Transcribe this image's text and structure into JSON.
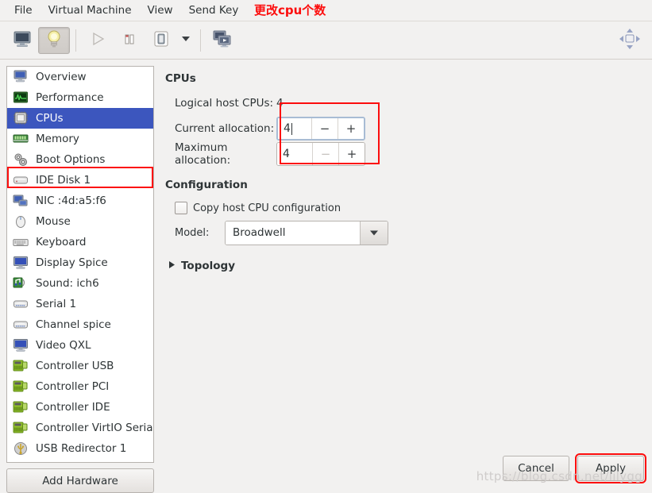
{
  "menubar": {
    "items": [
      {
        "label": "File",
        "name": "menu-file"
      },
      {
        "label": "Virtual Machine",
        "name": "menu-virtual-machine"
      },
      {
        "label": "View",
        "name": "menu-view"
      },
      {
        "label": "Send Key",
        "name": "menu-send-key"
      }
    ],
    "annotation": "更改cpu个数",
    "annotation_color": "#fc0d0d"
  },
  "toolbar": {
    "buttons": [
      {
        "name": "show-console-icon",
        "state": "normal"
      },
      {
        "name": "show-details-lightbulb-icon",
        "state": "pressed"
      },
      {
        "name": "run-play-icon",
        "state": "disabled"
      },
      {
        "name": "pause-icon",
        "state": "normal"
      },
      {
        "name": "shutdown-icon",
        "state": "normal"
      },
      {
        "name": "shutdown-dropdown-caret-icon",
        "state": "normal"
      },
      {
        "name": "snapshots-screens-icon",
        "state": "normal"
      },
      {
        "name": "fullscreen-expand-icon",
        "state": "normal"
      }
    ]
  },
  "sidebar": {
    "selected_index": 2,
    "selection_color": "#3c56be",
    "items": [
      {
        "label": "Overview",
        "icon": "monitor-icon"
      },
      {
        "label": "Performance",
        "icon": "performance-graph-icon"
      },
      {
        "label": "CPUs",
        "icon": "cpu-chip-icon"
      },
      {
        "label": "Memory",
        "icon": "memory-stick-icon"
      },
      {
        "label": "Boot Options",
        "icon": "gears-icon"
      },
      {
        "label": "IDE Disk 1",
        "icon": "disk-icon"
      },
      {
        "label": "NIC :4d:a5:f6",
        "icon": "network-card-icon"
      },
      {
        "label": "Mouse",
        "icon": "mouse-icon"
      },
      {
        "label": "Keyboard",
        "icon": "keyboard-icon"
      },
      {
        "label": "Display Spice",
        "icon": "display-icon"
      },
      {
        "label": "Sound: ich6",
        "icon": "sound-icon"
      },
      {
        "label": "Serial 1",
        "icon": "serial-port-icon"
      },
      {
        "label": "Channel spice",
        "icon": "channel-icon"
      },
      {
        "label": "Video QXL",
        "icon": "video-icon"
      },
      {
        "label": "Controller USB",
        "icon": "controller-card-icon"
      },
      {
        "label": "Controller PCI",
        "icon": "controller-card-icon"
      },
      {
        "label": "Controller IDE",
        "icon": "controller-card-icon"
      },
      {
        "label": "Controller VirtIO Serial",
        "icon": "controller-card-icon"
      },
      {
        "label": "USB Redirector 1",
        "icon": "usb-icon"
      }
    ],
    "add_hardware_label": "Add Hardware"
  },
  "cpus": {
    "section_title": "CPUs",
    "logical_host_label": "Logical host CPUs:",
    "logical_host_value": "4",
    "current_alloc_label": "Current allocation:",
    "current_alloc_value": "4",
    "max_alloc_label": "Maximum allocation:",
    "max_alloc_value": "4",
    "minus_symbol": "−",
    "plus_symbol": "+"
  },
  "configuration": {
    "section_title": "Configuration",
    "copy_host_label": "Copy host CPU configuration",
    "copy_host_checked": false,
    "model_label": "Model:",
    "model_value": "Broadwell",
    "topology_label": "Topology",
    "topology_expanded": false
  },
  "footer": {
    "cancel_label": "Cancel",
    "apply_label": "Apply",
    "watermark": "https://blog.csdn.net/lilygg"
  }
}
